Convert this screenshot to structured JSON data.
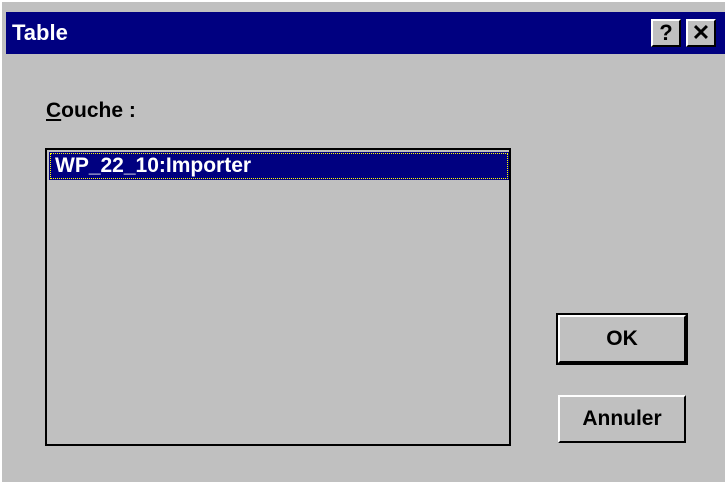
{
  "dialog": {
    "title": "Table",
    "help_label": "?",
    "close_label": "✕"
  },
  "layer": {
    "label_accel": "C",
    "label_rest": "ouche :",
    "items": [
      {
        "label": "WP_22_10:Importer",
        "selected": true
      }
    ]
  },
  "buttons": {
    "ok_label": "OK",
    "cancel_label": "Annuler"
  },
  "colors": {
    "titlebar": "#000080",
    "selection": "#000080",
    "face": "#c0c0c0"
  }
}
